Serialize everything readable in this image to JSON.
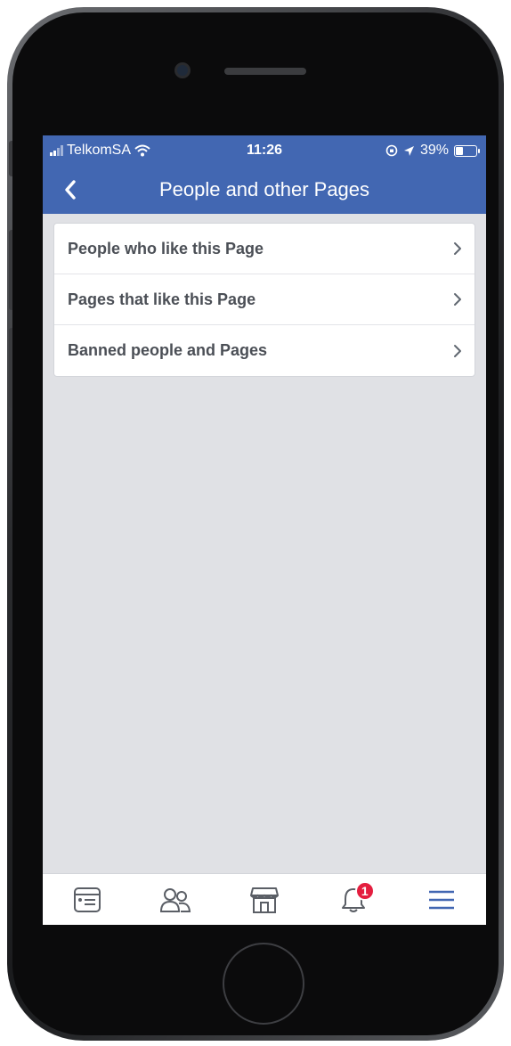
{
  "status_bar": {
    "carrier": "TelkomSA",
    "time": "11:26",
    "battery_percent": "39%",
    "battery_level": 0.39
  },
  "nav": {
    "title": "People and other Pages",
    "back_icon": "chevron-left-icon"
  },
  "menu": {
    "items": [
      {
        "label": "People who like this Page"
      },
      {
        "label": "Pages that like this Page"
      },
      {
        "label": "Banned people and Pages"
      }
    ]
  },
  "tab_bar": {
    "tabs": [
      {
        "icon": "news-feed-icon"
      },
      {
        "icon": "friends-icon"
      },
      {
        "icon": "marketplace-icon"
      },
      {
        "icon": "notifications-icon",
        "badge": "1"
      },
      {
        "icon": "menu-icon",
        "active": true
      }
    ]
  },
  "colors": {
    "brand": "#4267b2",
    "background": "#e0e1e5",
    "text": "#4b4f56",
    "badge": "#e41e3f"
  }
}
